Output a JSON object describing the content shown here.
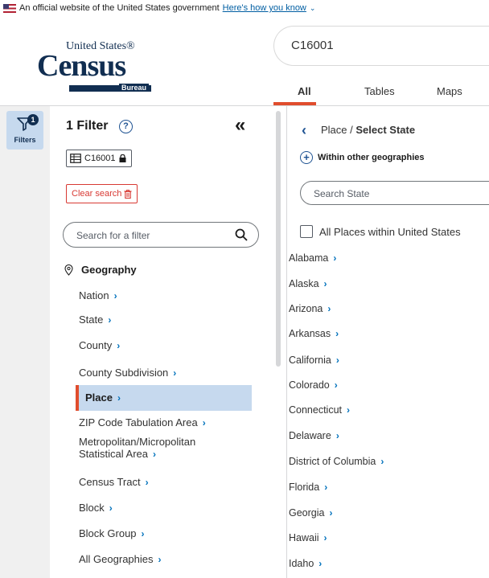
{
  "gov_banner": {
    "text": "An official website of the United States government",
    "link": "Here's how you know",
    "chevron": "chevron-down-icon"
  },
  "header": {
    "logo": {
      "line1": "United States®",
      "line2": "Census",
      "line3": "Bureau"
    },
    "search_value": "C16001",
    "tabs": [
      {
        "label": "All",
        "active": true
      },
      {
        "label": "Tables",
        "active": false
      },
      {
        "label": "Maps",
        "active": false
      }
    ]
  },
  "rail": {
    "filters_label": "Filters",
    "badge_count": "1",
    "icon": "funnel-icon"
  },
  "filter_panel": {
    "title": "1 Filter",
    "help_icon": "?",
    "collapse_icon": "«",
    "chip_label": "C16001",
    "clear_search_label": "Clear search",
    "search_placeholder": "Search for a filter",
    "geography_heading": "Geography",
    "geo_items": [
      {
        "label": "Nation",
        "selected": false
      },
      {
        "label": "State",
        "selected": false
      },
      {
        "label": "County",
        "selected": false
      },
      {
        "label": "County Subdivision",
        "selected": false
      },
      {
        "label": "Place",
        "selected": true
      },
      {
        "label": "ZIP Code Tabulation Area",
        "selected": false
      },
      {
        "label": "Metropolitan/Micropolitan Statistical Area",
        "selected": false
      },
      {
        "label": "Census Tract",
        "selected": false
      },
      {
        "label": "Block",
        "selected": false
      },
      {
        "label": "Block Group",
        "selected": false
      },
      {
        "label": "All Geographies",
        "selected": false
      }
    ],
    "chevron": "›"
  },
  "right_pane": {
    "breadcrumb_prefix": "Place /",
    "breadcrumb_current": "Select State",
    "within_label": "Within other geographies",
    "state_search_placeholder": "Search State",
    "all_places_label": "All Places within United States",
    "states": [
      "Alabama",
      "Alaska",
      "Arizona",
      "Arkansas",
      "California",
      "Colorado",
      "Connecticut",
      "Delaware",
      "District of Columbia",
      "Florida",
      "Georgia",
      "Hawaii",
      "Idaho"
    ]
  },
  "colors": {
    "navy": "#112e51",
    "link_blue": "#005ea2",
    "selected_bg": "#c6d9ee",
    "accent_orange": "#e04d2d",
    "danger_red": "#d83933"
  }
}
